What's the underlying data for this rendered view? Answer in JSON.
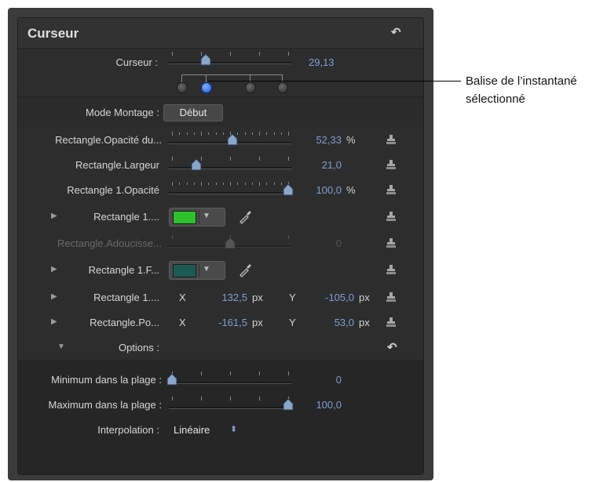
{
  "panel": {
    "title": "Curseur"
  },
  "curseur": {
    "label": "Curseur :",
    "value": "29,13"
  },
  "mode_montage": {
    "label": "Mode Montage :",
    "button": "Début"
  },
  "rows": {
    "opacite_du": {
      "label": "Rectangle.Opacité du...",
      "value": "52,33",
      "unit": "%"
    },
    "largeur": {
      "label": "Rectangle.Largeur",
      "value": "21,0"
    },
    "opacite1": {
      "label": "Rectangle 1.Opacité",
      "value": "100,0",
      "unit": "%"
    },
    "color1": {
      "label": "Rectangle 1....",
      "color": "#2fc12a"
    },
    "adoucisse": {
      "label": "Rectangle.Adoucisse...",
      "value": "0"
    },
    "color2": {
      "label": "Rectangle 1.F...",
      "color": "#1c5a55"
    },
    "pos1": {
      "label": "Rectangle 1....",
      "x_label": "X",
      "x_value": "132,5",
      "x_unit": "px",
      "y_label": "Y",
      "y_value": "-105,0",
      "y_unit": "px"
    },
    "pos2": {
      "label": "Rectangle.Po...",
      "x_label": "X",
      "x_value": "-161,5",
      "x_unit": "px",
      "y_label": "Y",
      "y_value": "53,0",
      "y_unit": "px"
    }
  },
  "options": {
    "label": "Options :",
    "minimum": {
      "label": "Minimum dans la plage :",
      "value": "0"
    },
    "maximum": {
      "label": "Maximum dans la plage :",
      "value": "100,0"
    },
    "interpolation": {
      "label": "Interpolation :",
      "value": "Linéaire"
    }
  },
  "callout": {
    "line1": "Balise de l’instantané",
    "line2": "sélectionné"
  },
  "icons": {
    "reset": "reset-arrow-icon",
    "stamp": "rig-stamp-icon",
    "dropper": "eyedropper-icon"
  },
  "sliders": {
    "curseur_fraction": 0.29,
    "opacite_du_fraction": 0.52,
    "largeur_fraction": 0.21,
    "opacite1_fraction": 1.0,
    "adoucisse_fraction": 0.5,
    "minimum_fraction": 0.0,
    "maximum_fraction": 1.0
  },
  "snapshot_pins": {
    "positions": [
      0.1,
      0.3,
      0.66,
      0.92
    ],
    "selected_index": 1
  }
}
